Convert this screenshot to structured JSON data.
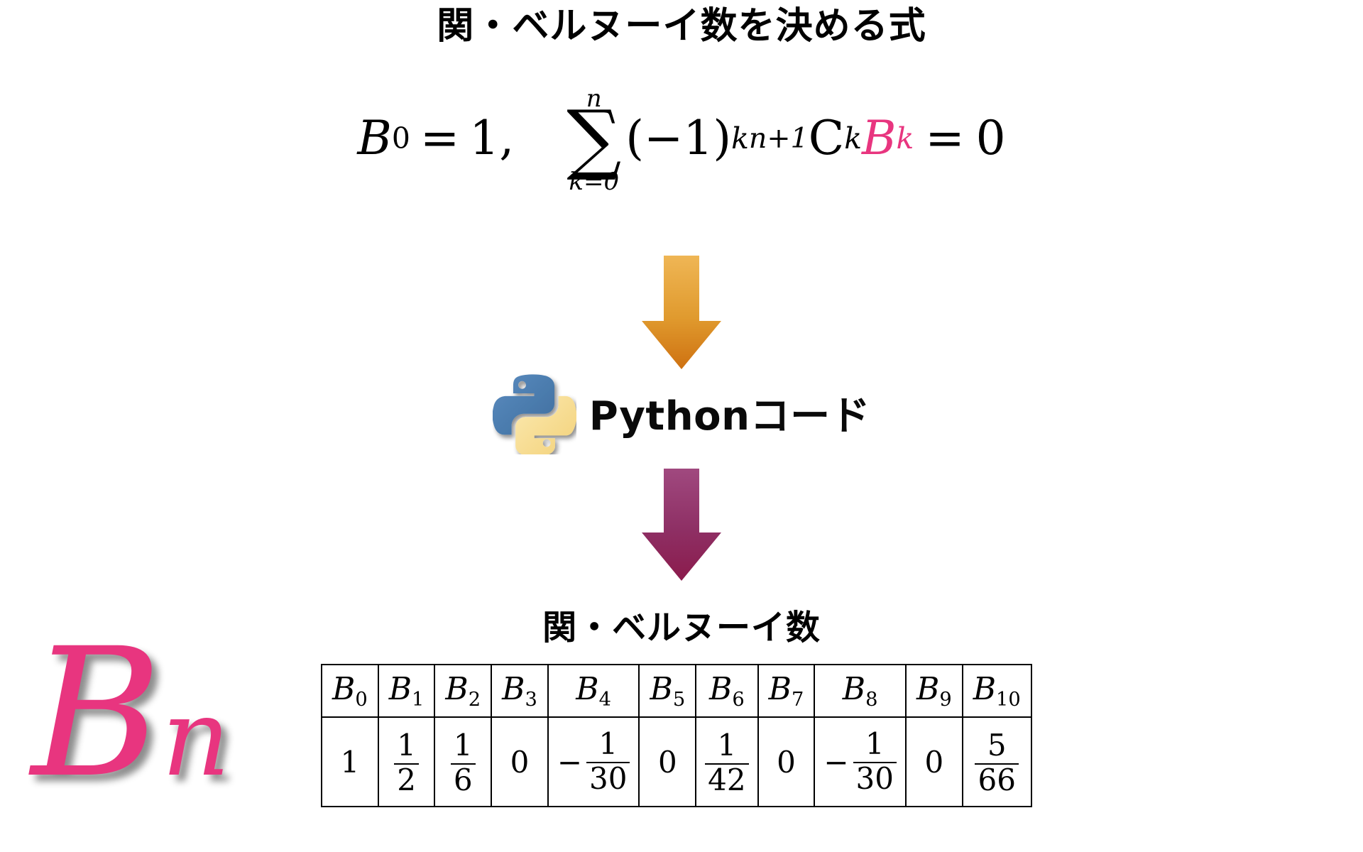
{
  "formula_section": {
    "title": "関・ベルヌーイ数を決める式",
    "equation": {
      "initial_lhs_base": "B",
      "initial_lhs_sub": "0",
      "equals": "=",
      "initial_value": "1",
      "comma": ",",
      "sigma_glyph": "∑",
      "sigma_upper": "n",
      "sigma_lower": "k=0",
      "open_paren": "(",
      "minus_one": "−1",
      "close_paren": ")",
      "exponent": "k",
      "combination_presub": "n+1",
      "combination_symbol": "C",
      "combination_sub": "k",
      "bernoulli_base": "B",
      "bernoulli_sub": "k",
      "equals2": "=",
      "rhs": "0",
      "highlight_color": "#E8357F"
    }
  },
  "flow": {
    "arrow_down_1": {
      "icon": "arrow-down-icon",
      "color_top": "#E8A93C",
      "color_bottom": "#D3791B"
    },
    "python": {
      "logo_icon": "python-logo-icon",
      "label": "Pythonコード",
      "logo_blue": "#4B7BAF",
      "logo_yellow": "#F7DB8E"
    },
    "arrow_down_2": {
      "icon": "arrow-down-icon",
      "color_top": "#9C3A77",
      "color_bottom": "#8E1F4F"
    }
  },
  "table_section": {
    "title": "関・ベルヌーイ数",
    "big_label": {
      "base": "B",
      "sub": "n",
      "color": "#E8357F"
    },
    "headers": [
      {
        "base": "B",
        "sub": "0"
      },
      {
        "base": "B",
        "sub": "1"
      },
      {
        "base": "B",
        "sub": "2"
      },
      {
        "base": "B",
        "sub": "3"
      },
      {
        "base": "B",
        "sub": "4"
      },
      {
        "base": "B",
        "sub": "5"
      },
      {
        "base": "B",
        "sub": "6"
      },
      {
        "base": "B",
        "sub": "7"
      },
      {
        "base": "B",
        "sub": "8"
      },
      {
        "base": "B",
        "sub": "9"
      },
      {
        "base": "B",
        "sub": "10"
      }
    ],
    "values": [
      {
        "type": "integer",
        "text": "1"
      },
      {
        "type": "fraction",
        "sign": "",
        "num": "1",
        "den": "2"
      },
      {
        "type": "fraction",
        "sign": "",
        "num": "1",
        "den": "6"
      },
      {
        "type": "integer",
        "text": "0"
      },
      {
        "type": "fraction",
        "sign": "−",
        "num": "1",
        "den": "30"
      },
      {
        "type": "integer",
        "text": "0"
      },
      {
        "type": "fraction",
        "sign": "",
        "num": "1",
        "den": "42"
      },
      {
        "type": "integer",
        "text": "0"
      },
      {
        "type": "fraction",
        "sign": "−",
        "num": "1",
        "den": "30"
      },
      {
        "type": "integer",
        "text": "0"
      },
      {
        "type": "fraction",
        "sign": "",
        "num": "5",
        "den": "66"
      }
    ]
  }
}
